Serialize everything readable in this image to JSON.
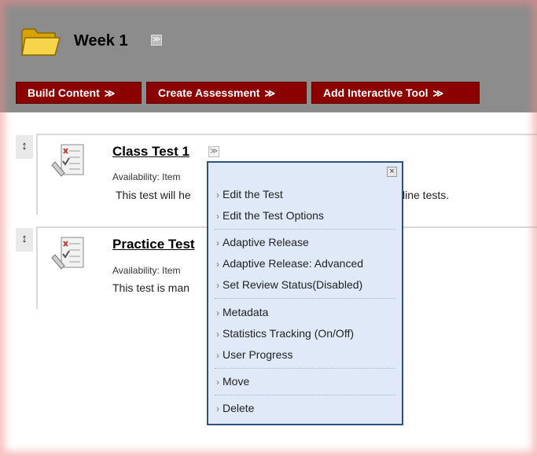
{
  "header": {
    "title": "Week 1",
    "title_menu_icon": "double-chevron-down-icon"
  },
  "toolbar": {
    "buttons": [
      {
        "label": "Build Content",
        "chevron": "≫"
      },
      {
        "label": "Create Assessment",
        "chevron": "≫"
      },
      {
        "label": "Add Interactive Tool",
        "chevron": "≫"
      }
    ]
  },
  "items": [
    {
      "title": "Class Test 1",
      "availability": "Availability:  Item",
      "description_left": "This test will he",
      "description_right": "line tests."
    },
    {
      "title": "Practice Test",
      "availability": "Availability:  Item",
      "description_left": "This test is man"
    }
  ],
  "context_menu": {
    "close_label": "×",
    "items": [
      "Edit the Test",
      "Edit the Test Options",
      "Adaptive Release",
      "Adaptive Release: Advanced",
      "Set Review Status(Disabled)",
      "Metadata",
      "Statistics Tracking (On/Off)",
      "User Progress",
      "Move",
      "Delete"
    ]
  },
  "colors": {
    "header_bg": "#8c8c8c",
    "button_bg": "#8b0000",
    "menu_bg": "#dfe9f7",
    "menu_border": "#2f4f7f"
  }
}
